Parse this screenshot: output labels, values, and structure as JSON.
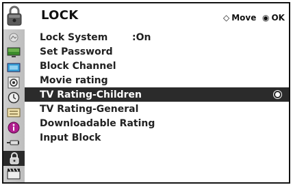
{
  "header": {
    "title": "LOCK",
    "icon": "padlock-icon",
    "move_glyph": "◇",
    "move_label": "Move",
    "ok_glyph": "◉",
    "ok_label": "OK"
  },
  "sidebar": {
    "items": [
      {
        "icon": "picture-icon"
      },
      {
        "icon": "tv-screen-icon"
      },
      {
        "icon": "aspect-ratio-icon"
      },
      {
        "icon": "audio-icon"
      },
      {
        "icon": "clock-icon"
      },
      {
        "icon": "option-icon"
      },
      {
        "icon": "info-icon"
      },
      {
        "icon": "input-icon"
      },
      {
        "icon": "lock-icon",
        "active": true
      },
      {
        "icon": "clapperboard-icon"
      }
    ]
  },
  "menu": {
    "items": [
      {
        "label": "Lock System",
        "value": ":On"
      },
      {
        "label": "Set Password"
      },
      {
        "label": "Block Channel"
      },
      {
        "label": "Movie rating"
      },
      {
        "label": "TV Rating-Children",
        "selected": true
      },
      {
        "label": "TV Rating-General"
      },
      {
        "label": "Downloadable Rating"
      },
      {
        "label": "Input Block"
      }
    ]
  },
  "colors": {
    "selected_bg": "#2b2b2b",
    "sidebar_bg": "#c4c4c4",
    "frame": "#111111"
  }
}
